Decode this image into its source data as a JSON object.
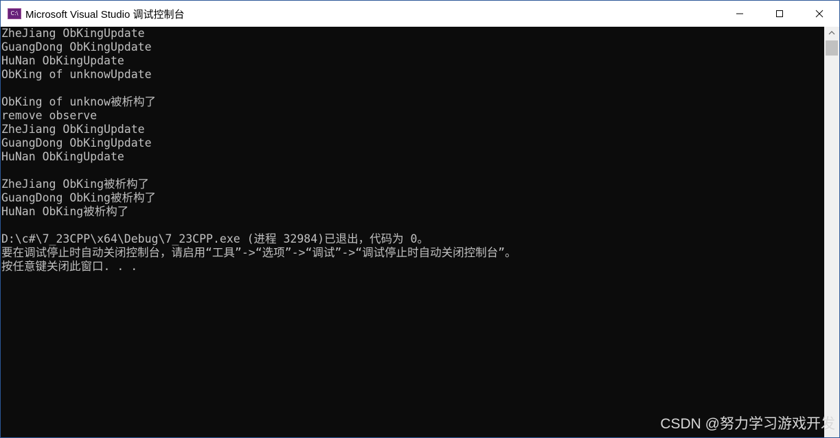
{
  "window": {
    "app_icon_text": "C:\\",
    "title": "Microsoft Visual Studio 调试控制台"
  },
  "console": {
    "lines": [
      "ZheJiang ObKingUpdate",
      "GuangDong ObKingUpdate",
      "HuNan ObKingUpdate",
      "ObKing of unknowUpdate",
      "",
      "ObKing of unknow被析构了",
      "remove observe",
      "ZheJiang ObKingUpdate",
      "GuangDong ObKingUpdate",
      "HuNan ObKingUpdate",
      "",
      "ZheJiang ObKing被析构了",
      "GuangDong ObKing被析构了",
      "HuNan ObKing被析构了",
      "",
      "D:\\c#\\7_23CPP\\x64\\Debug\\7_23CPP.exe (进程 32984)已退出，代码为 0。",
      "要在调试停止时自动关闭控制台，请启用“工具”->“选项”->“调试”->“调试停止时自动关闭控制台”。",
      "按任意键关闭此窗口. . ."
    ]
  },
  "watermark": "CSDN @努力学习游戏开发",
  "colors": {
    "console_background": "#0c0c0c",
    "console_text": "#c0c0c0",
    "titlebar_background": "#ffffff"
  },
  "icons": {
    "app": "visual-studio-console-icon",
    "minimize": "minimize-icon",
    "maximize": "maximize-icon",
    "close": "close-icon",
    "scroll_up": "chevron-up-icon"
  }
}
